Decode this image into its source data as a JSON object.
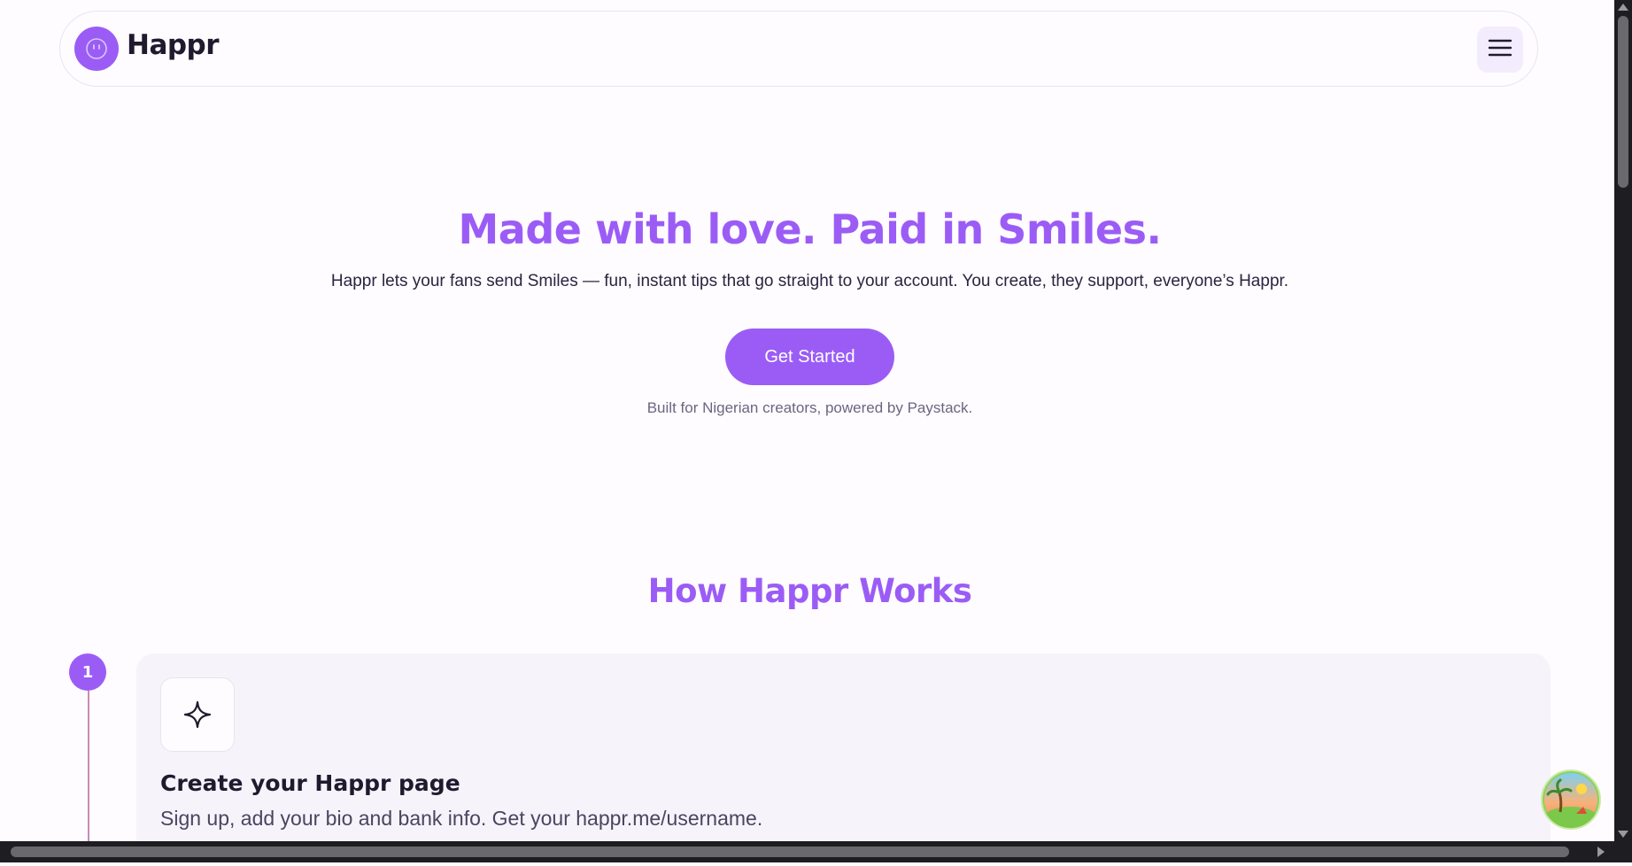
{
  "header": {
    "brand": "Happr",
    "logo_icon": "smiley-icon",
    "menu_icon": "hamburger-menu-icon"
  },
  "hero": {
    "title": "Made with love. Paid in Smiles.",
    "subtitle": "Happr lets your fans send Smiles — fun, instant tips that go straight to your account. You create, they support, everyone’s Happr.",
    "cta_label": "Get Started",
    "note": "Built for Nigerian creators, powered by Paystack."
  },
  "how_it_works": {
    "title": "How Happr Works",
    "steps": [
      {
        "number": "1",
        "icon": "sparkle-icon",
        "title": "Create your Happr page",
        "description": "Sign up, add your bio and bank info. Get your happr.me/username."
      }
    ]
  },
  "colors": {
    "accent": "#9b5cf6",
    "text_dark": "#1f1a2e",
    "card_bg": "#f6f3fa",
    "page_bg": "#fefcfe"
  }
}
